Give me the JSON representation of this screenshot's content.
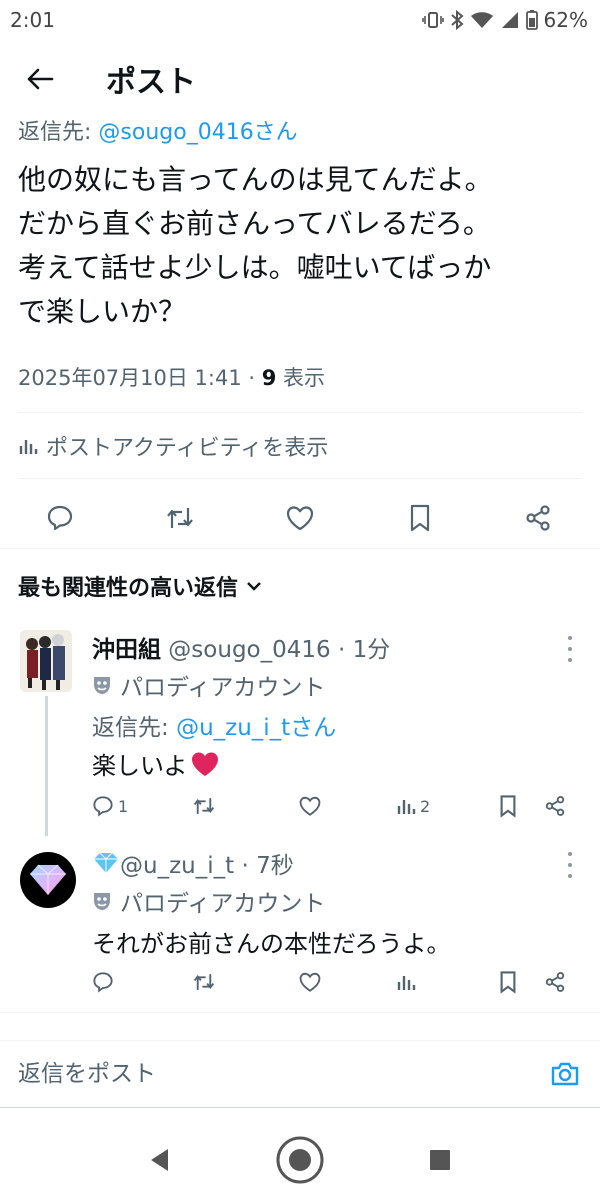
{
  "status_bar": {
    "time": "2:01",
    "battery": "62%"
  },
  "header": {
    "title": "ポスト"
  },
  "post": {
    "reply_prefix": "返信先: ",
    "reply_handle": "@sougo_0416さん",
    "lines": [
      "他の奴にも言ってんのは見てんだよ。",
      "だから直ぐお前さんってバレるだろ。",
      "考えて話せよ少しは。嘘吐いてばっか",
      "で楽しいか？"
    ],
    "timestamp": "2025年07月10日 1:41 · ",
    "views_count": "9",
    "views_label": " 表示",
    "activity_label": "ポストアクティビティを表示"
  },
  "sort": {
    "label": "最も関連性の高い返信"
  },
  "replies": [
    {
      "name": "沖田組",
      "meta": " @sougo_0416 · 1分",
      "label": "パロディアカウント",
      "reply_prefix": "返信先: ",
      "reply_handle": "@u_zu_i_tさん",
      "text": "楽しいよ",
      "reply_count": "1",
      "view_count": "2"
    },
    {
      "name": "",
      "meta": " @u_zu_i_t · 7秒",
      "label": "パロディアカウント",
      "text": "それがお前さんの本性だろうよ。"
    }
  ],
  "reply_input": {
    "placeholder": "返信をポスト"
  },
  "colors": {
    "accent": "#1d9bf0",
    "text": "#0f1419",
    "muted": "#536471",
    "heart": "#e0245e"
  }
}
